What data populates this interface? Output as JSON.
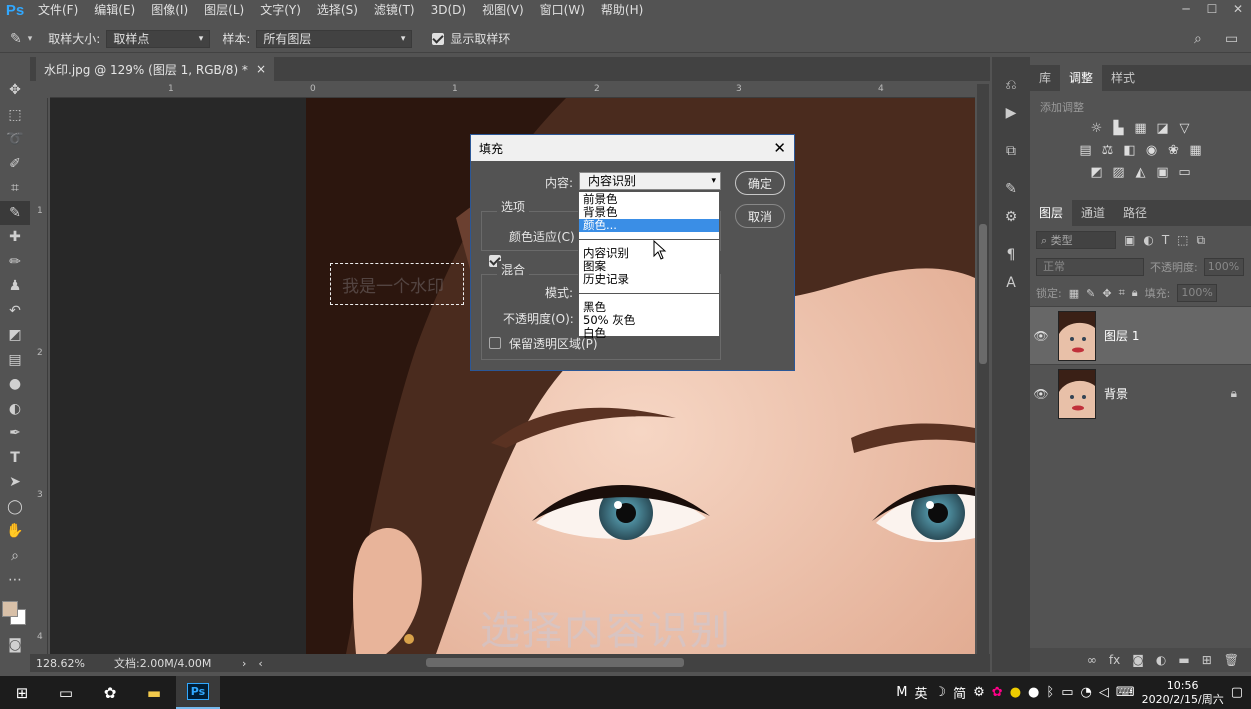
{
  "app": {
    "logo": "Ps"
  },
  "menu": [
    "文件(F)",
    "编辑(E)",
    "图像(I)",
    "图层(L)",
    "文字(Y)",
    "选择(S)",
    "滤镜(T)",
    "3D(D)",
    "视图(V)",
    "窗口(W)",
    "帮助(H)"
  ],
  "options": {
    "sample_size_label": "取样大小:",
    "sample_size_value": "取样点",
    "sample_label": "样本:",
    "sample_value": "所有图层",
    "show_ring_label": "显示取样环"
  },
  "document": {
    "tab_title": "水印.jpg @ 129% (图层 1, RGB/8) *",
    "close": "×"
  },
  "ruler": {
    "h": [
      "1",
      "0",
      "1",
      "2",
      "3",
      "4"
    ],
    "v": [
      "1",
      "2",
      "3",
      "4"
    ]
  },
  "canvas": {
    "watermark_text": "我是一个水印"
  },
  "status": {
    "zoom": "128.62%",
    "doc": "文档:2.00M/4.00M"
  },
  "panels": {
    "top_tabs": [
      "库",
      "调整",
      "样式"
    ],
    "add_adjustment": "添加调整",
    "layer_tabs": [
      "图层",
      "通道",
      "路径"
    ],
    "kind_label": "类型",
    "blend_mode": "正常",
    "opacity_label": "不透明度:",
    "opacity_value": "100%",
    "lock_label": "锁定:",
    "fill_label": "填充:",
    "fill_value": "100%"
  },
  "layers": [
    {
      "name": "图层 1"
    },
    {
      "name": "背景"
    }
  ],
  "dialog": {
    "title": "填充",
    "content_label": "内容:",
    "content_value": "内容识别",
    "ok": "确定",
    "cancel": "取消",
    "options_label": "选项",
    "color_adapt": "颜色适应(C)",
    "blend_label": "混合",
    "mode_label": "模式:",
    "opacity_label": "不透明度(O):",
    "preserve": "保留透明区域(P)"
  },
  "dropdown": {
    "group1": [
      "前景色",
      "背景色",
      "颜色..."
    ],
    "group2": [
      "内容识别",
      "图案",
      "历史记录"
    ],
    "group3": [
      "黑色",
      "50% 灰色",
      "白色"
    ],
    "highlighted": "颜色..."
  },
  "subtitle": "选择内容识别",
  "taskbar": {
    "ime1": "M",
    "ime2": "英",
    "ime3": "简",
    "time": "10:56",
    "date": "2020/2/15/周六"
  }
}
